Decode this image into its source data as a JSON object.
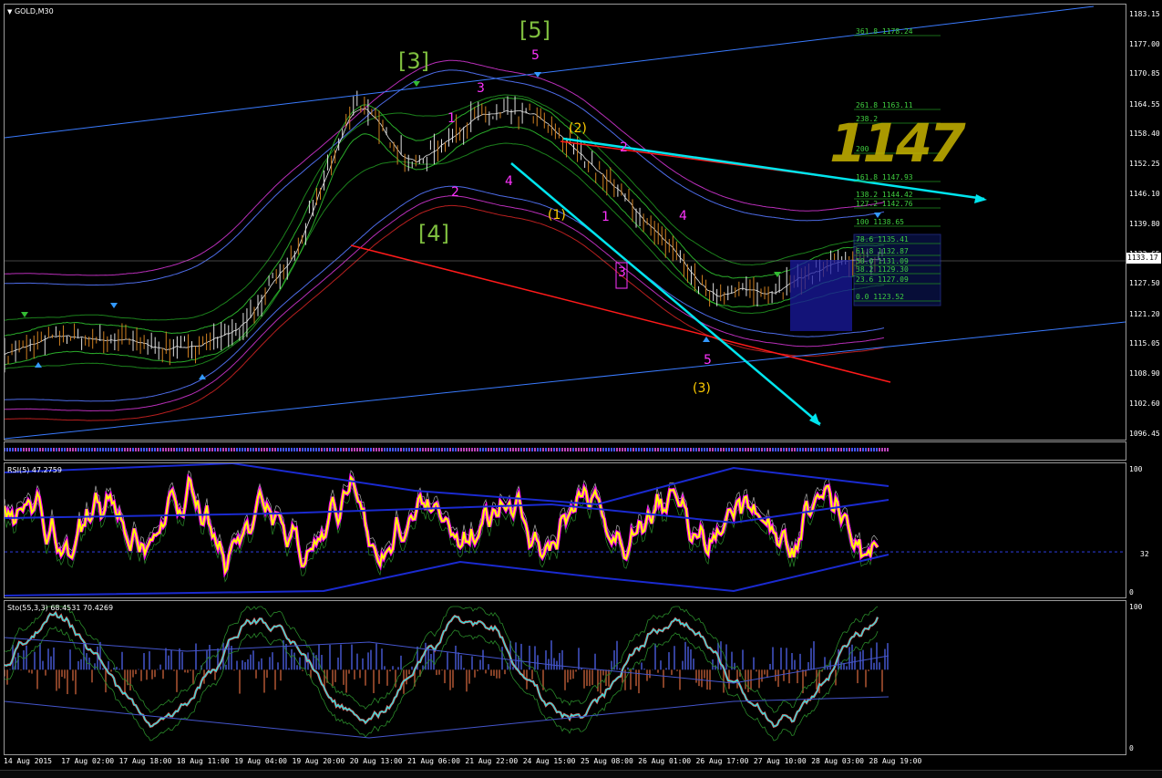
{
  "window": {
    "symbol_title": "GOLD,M30",
    "current_price": "1133.17"
  },
  "colors": {
    "bg": "#000000",
    "bull": "#00cc00",
    "blue_channel": "#3a7bff",
    "red_line": "#ff1a1a",
    "cyan": "#00e5ee",
    "rsi": "#ffff00",
    "rsi_dots": "#ff00ff",
    "wave_green": "#7fbf3f",
    "wave_magenta": "#ff33ff",
    "wave_yellow": "#ffcc00",
    "hist_pos": "#4455cc",
    "hist_neg": "#b05533"
  },
  "main_chart": {
    "price_ticks": [
      "1183.15",
      "1177.00",
      "1170.85",
      "1164.55",
      "1158.40",
      "1152.25",
      "1146.10",
      "1139.80",
      "1133.65",
      "1127.50",
      "1121.20",
      "1115.05",
      "1108.90",
      "1102.60",
      "1096.45"
    ],
    "time_labels": [
      "14 Aug 2015",
      "17 Aug 02:00",
      "17 Aug 18:00",
      "18 Aug 11:00",
      "19 Aug 04:00",
      "19 Aug 20:00",
      "20 Aug 13:00",
      "21 Aug 06:00",
      "21 Aug 22:00",
      "24 Aug 15:00",
      "25 Aug 08:00",
      "26 Aug 01:00",
      "26 Aug 17:00",
      "27 Aug 10:00",
      "28 Aug 03:00",
      "28 Aug 19:00"
    ],
    "fib_levels": [
      {
        "label": "361.8",
        "price": "1178.24"
      },
      {
        "label": "261.8",
        "price": "1163.11"
      },
      {
        "label": "238.2",
        "price": ""
      },
      {
        "label": "200",
        "price": ""
      },
      {
        "label": "161.8",
        "price": "1147.93"
      },
      {
        "label": "138.2",
        "price": "1144.42"
      },
      {
        "label": "127.2",
        "price": "1142.76"
      },
      {
        "label": "100",
        "price": "1138.65"
      },
      {
        "label": "78.6",
        "price": "1135.41"
      },
      {
        "label": "61.8",
        "price": "1132.87"
      },
      {
        "label": "50.0",
        "price": "1131.09"
      },
      {
        "label": "38.2",
        "price": "1129.30"
      },
      {
        "label": "23.6",
        "price": "1127.09"
      },
      {
        "label": "0.0",
        "price": "1123.52"
      }
    ],
    "wave_labels": {
      "w3": "[3]",
      "w4": "[4]",
      "w5": "[5]",
      "m1": "1",
      "m2": "2",
      "m3": "3",
      "m4": "4",
      "m5": "5",
      "n1": "1",
      "n2": "2",
      "n3": "3",
      "n4": "4",
      "n5": "5",
      "p1": "(1)",
      "p2": "(2)",
      "p3": "(3)"
    },
    "watermark": "1147",
    "chart_data": {
      "type": "line",
      "title": "GOLD,M30",
      "ylim": [
        1096.45,
        1183.15
      ],
      "x": [
        "14 Aug 2015",
        "17 Aug 02:00",
        "17 Aug 18:00",
        "18 Aug 11:00",
        "19 Aug 04:00",
        "19 Aug 20:00",
        "20 Aug 13:00",
        "21 Aug 06:00",
        "21 Aug 22:00",
        "24 Aug 15:00",
        "25 Aug 08:00",
        "26 Aug 01:00",
        "26 Aug 17:00",
        "27 Aug 10:00",
        "28 Aug 03:00",
        "28 Aug 19:00"
      ],
      "series": [
        {
          "values": [
            1113,
            1117,
            1116,
            1114,
            1118,
            1134,
            1166,
            1152,
            1162,
            1163,
            1153,
            1140,
            1126,
            1126,
            1131,
            1133
          ]
        }
      ]
    }
  },
  "rsi_pane": {
    "title": "RSI(5) 47.2759",
    "ticks": [
      "100",
      "32",
      "0"
    ]
  },
  "sto_pane": {
    "title": "Sto(55,3,3) 68.4531 70.4269",
    "ticks": [
      "100",
      "0"
    ]
  }
}
